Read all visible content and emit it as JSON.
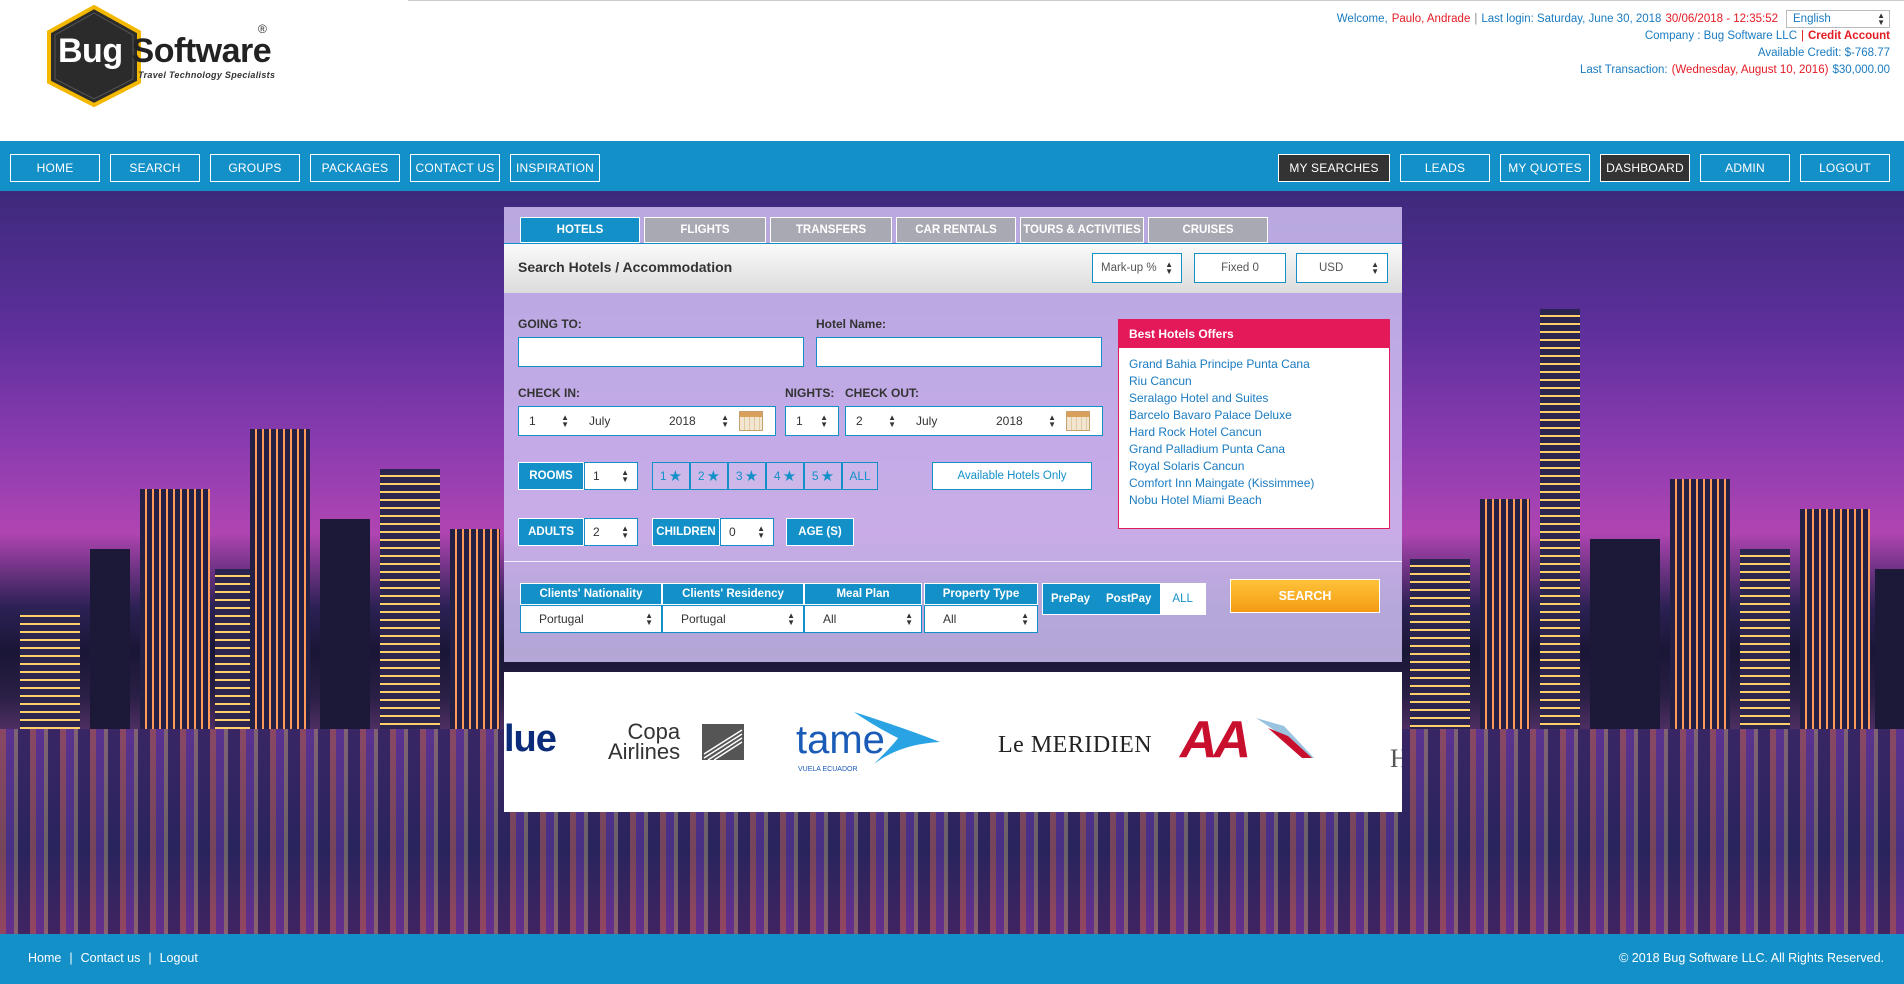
{
  "brand": {
    "word1": "Bug",
    "word2": "Software",
    "registered": "®",
    "tagline": "Travel Technology Specialists",
    "hex_color": "#2b2b2b",
    "hex_border": "#f5b800"
  },
  "account": {
    "welcome_label": "Welcome,",
    "user_name": "Paulo, Andrade",
    "separator": "|",
    "last_login_label": "Last login: Saturday, June 30, 2018",
    "last_login_time": "30/06/2018 - 12:35:52",
    "language": "English",
    "company_label": "Company : Bug Software LLC",
    "credit_account": "Credit Account",
    "available_credit": "Available Credit: $-768.77",
    "last_transaction_label": "Last Transaction:",
    "last_transaction_date": "(Wednesday, August 10, 2016)",
    "last_transaction_amount": "$30,000.00"
  },
  "nav": {
    "left": [
      "HOME",
      "SEARCH",
      "GROUPS",
      "PACKAGES",
      "CONTACT US",
      "INSPIRATION"
    ],
    "right": [
      "MY SEARCHES",
      "LEADS",
      "MY QUOTES",
      "DASHBOARD",
      "ADMIN",
      "LOGOUT"
    ]
  },
  "tabs": [
    "HOTELS",
    "FLIGHTS",
    "TRANSFERS",
    "CAR RENTALS",
    "TOURS & ACTIVITIES",
    "CRUISES"
  ],
  "search": {
    "title": "Search Hotels / Accommodation",
    "markup": "Mark-up %",
    "fixed": "Fixed 0",
    "currency": "USD",
    "going_to_label": "GOING TO:",
    "hotel_name_label": "Hotel Name:",
    "check_in_label": "CHECK IN:",
    "nights_label": "NIGHTS:",
    "check_out_label": "CHECK OUT:",
    "check_in": {
      "day": "1",
      "month": "July",
      "year": "2018"
    },
    "nights": "1",
    "check_out": {
      "day": "2",
      "month": "July",
      "year": "2018"
    },
    "rooms_label": "ROOMS",
    "rooms": "1",
    "stars": [
      "1",
      "2",
      "3",
      "4",
      "5"
    ],
    "stars_all": "ALL",
    "available_only": "Available Hotels Only",
    "adults_label": "ADULTS",
    "adults": "2",
    "children_label": "CHILDREN",
    "children": "0",
    "ages_label": "AGE (S)",
    "filters": [
      {
        "label": "Clients' Nationality",
        "value": "Portugal"
      },
      {
        "label": "Clients' Residency",
        "value": "Portugal"
      },
      {
        "label": "Meal Plan",
        "value": "All"
      },
      {
        "label": "Property Type",
        "value": "All"
      }
    ],
    "prepay": "PrePay",
    "postpay": "PostPay",
    "pay_all": "ALL",
    "search_button": "SEARCH"
  },
  "offers": {
    "title": "Best Hotels Offers",
    "items": [
      "Grand Bahia Principe Punta Cana",
      "Riu Cancun",
      "Seralago Hotel and Suites",
      "Barcelo Bavaro Palace Deluxe",
      "Hard Rock Hotel Cancun",
      "Grand Palladium Punta Cana",
      "Royal Solaris Cancun",
      "Comfort Inn Maingate (Kissimmee)",
      "Nobu Hotel Miami Beach"
    ]
  },
  "partners": {
    "jetblue": "lue",
    "copa_line1": "Copa",
    "copa_line2": "Airlines",
    "tame": "tame",
    "tame_sub": "VUELA ECUADOR",
    "meridien": "Le MERIDIEN",
    "aa": "AA",
    "partial": "H"
  },
  "footer": {
    "links": [
      "Home",
      "Contact us",
      "Logout"
    ],
    "separator": "|",
    "copyright": "© 2018 Bug Software LLC. All Rights Reserved."
  },
  "colors": {
    "primary_blue": "#1490c9",
    "offers_pink": "#e3195a",
    "search_orange": "#f39c12",
    "dark_button": "#333333"
  }
}
